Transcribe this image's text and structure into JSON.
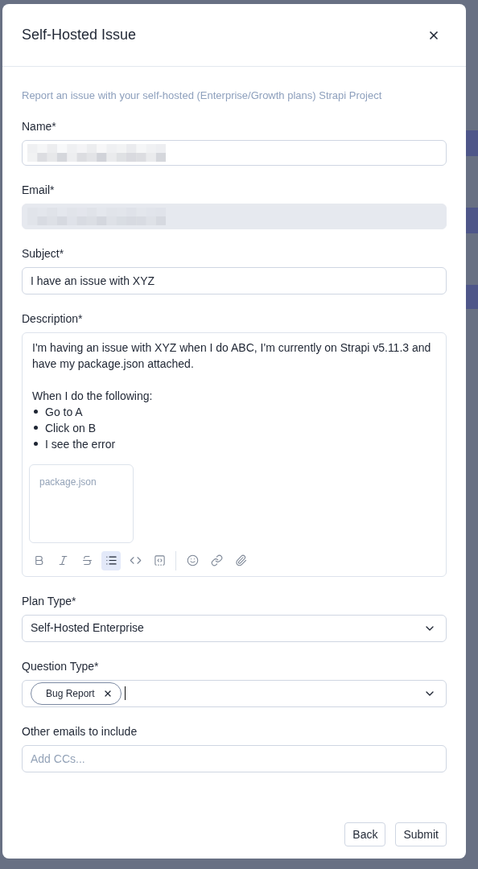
{
  "dialog": {
    "title": "Self-Hosted Issue",
    "intro": "Report an issue with your self-hosted (Enterprise/Growth plans) Strapi Project"
  },
  "fields": [
    {
      "kind": "redacted",
      "label": "Name*",
      "disabled": false
    },
    {
      "kind": "redacted",
      "label": "Email*",
      "disabled": true
    },
    {
      "kind": "text",
      "label": "Subject*",
      "value": "I have an issue with XYZ"
    },
    {
      "kind": "editor",
      "label": "Description*",
      "paragraphs": [
        "I'm having an issue with XYZ when I do ABC, I'm currently on Strapi v5.11.3 and have my package.json attached.",
        "When I do the following:"
      ],
      "bullets": [
        "Go to A",
        "Click on B",
        "I see the error"
      ],
      "attachment": "package.json",
      "toolbar": [
        {
          "kind": "bold",
          "active": false
        },
        {
          "kind": "italic",
          "active": false
        },
        {
          "kind": "strike",
          "active": false
        },
        {
          "kind": "bullet-list",
          "active": true
        },
        {
          "kind": "code",
          "active": false
        },
        {
          "kind": "code-block",
          "active": false
        },
        {
          "kind": "emoji",
          "active": false
        },
        {
          "kind": "link",
          "active": false
        },
        {
          "kind": "attach",
          "active": false
        }
      ]
    },
    {
      "kind": "select",
      "label": "Plan Type*",
      "value": "Self-Hosted Enterprise"
    },
    {
      "kind": "multiselect",
      "label": "Question Type*",
      "tags": [
        "Bug Report"
      ]
    },
    {
      "kind": "text",
      "label": "Other emails to include",
      "placeholder": "Add CCs..."
    }
  ],
  "buttons": [
    "Back",
    "Submit"
  ]
}
